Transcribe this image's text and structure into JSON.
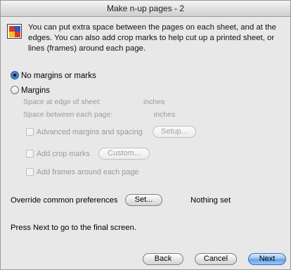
{
  "window": {
    "title": "Make n-up pages - 2"
  },
  "intro": {
    "text": "You can put extra space between the pages on each sheet, and at the edges. You can also add crop marks to help cut up a printed sheet, or lines (frames) around each page.",
    "icon": "app-icon"
  },
  "options": {
    "no_margins_label": "No margins or marks",
    "no_margins_selected": true,
    "margins_label": "Margins",
    "margins_selected": false
  },
  "margins": {
    "edge_label": "Space at edge of sheet:",
    "edge_unit": "inches",
    "between_label": "Space between each page:",
    "between_unit": "inches",
    "advanced_label": "Advanced margins and spacing",
    "setup_button": "Setup...",
    "crop_label": "Add crop marks",
    "custom_button": "Custom...",
    "frames_label": "Add frames around each page"
  },
  "preferences": {
    "label": "Override common preferences",
    "set_button": "Set...",
    "status": "Nothing set"
  },
  "footer": {
    "hint": "Press Next to go to the final screen.",
    "back_button": "Back",
    "cancel_button": "Cancel",
    "next_button": "Next"
  },
  "colors": {
    "default_button": "#5f9de8",
    "disabled_text": "#9a9a9a"
  }
}
